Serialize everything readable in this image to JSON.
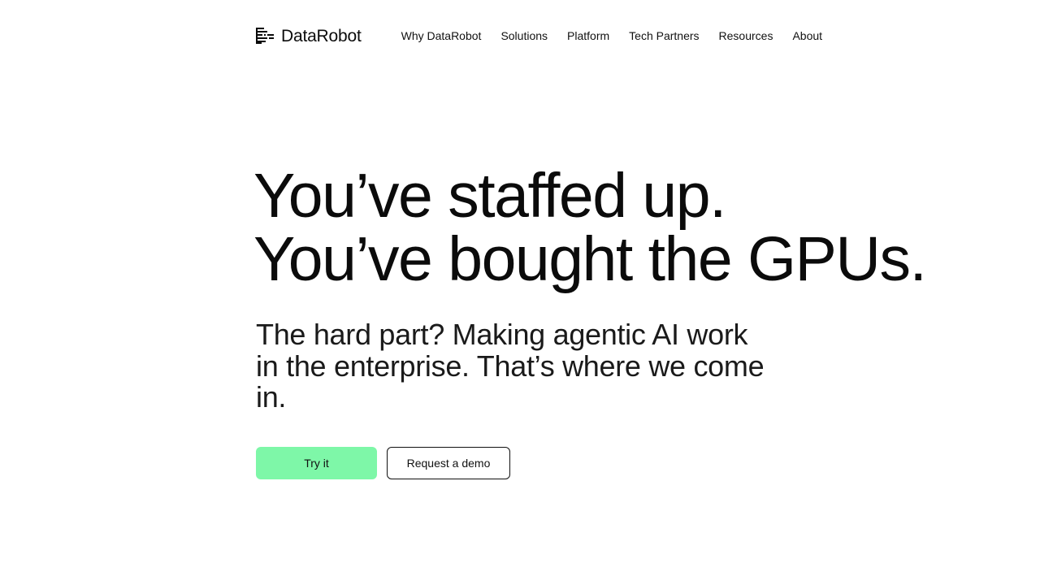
{
  "brand": {
    "name": "DataRobot",
    "icon": "datarobot-logo-icon"
  },
  "nav": {
    "items": [
      {
        "label": "Why DataRobot"
      },
      {
        "label": "Solutions"
      },
      {
        "label": "Platform"
      },
      {
        "label": "Tech Partners"
      },
      {
        "label": "Resources"
      },
      {
        "label": "About"
      }
    ]
  },
  "hero": {
    "title_lines": [
      "You’ve staffed up.",
      "You’ve bought the GPUs."
    ],
    "subtitle": "The hard part? Making agentic AI work in the enterprise. That’s where we come in.",
    "primary_cta": "Try it",
    "secondary_cta": "Request a demo"
  },
  "colors": {
    "background": "#ffffff",
    "text": "#0b0b0b",
    "accent": "#7ef7a8"
  }
}
